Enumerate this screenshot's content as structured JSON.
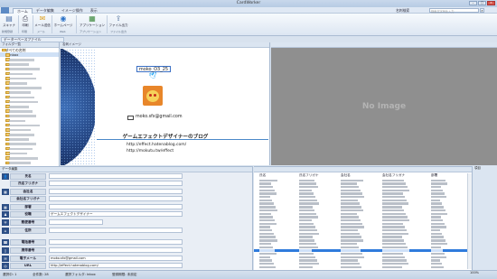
{
  "window": {
    "title": "CardWorker",
    "min": "–",
    "max": "□",
    "close": "×"
  },
  "menu": {
    "tabs": [
      "ホーム",
      "データ編集",
      "イメージ操作",
      "表示"
    ],
    "search_label": "名刺検索",
    "search_placeholder": "検索文字列を入力",
    "search_icon": "⌕"
  },
  "ribbon": {
    "buttons": [
      {
        "label": "スキャナ",
        "icon": "scanner-icon",
        "glyph": "▤"
      },
      {
        "label": "印刷",
        "icon": "printer-icon",
        "glyph": "⎙"
      },
      {
        "label": "メール送信",
        "icon": "mail-icon",
        "glyph": "✉"
      },
      {
        "label": "ホームページ",
        "icon": "globe-icon",
        "glyph": "◉"
      },
      {
        "label": "アプリケーション",
        "icon": "app-icon",
        "glyph": "▦"
      },
      {
        "label": "ファイル出力",
        "icon": "export-icon",
        "glyph": "⇪"
      }
    ],
    "groups": [
      "新規登録",
      "印刷",
      "メール",
      "Web",
      "アプリケーション",
      "ファイル出力"
    ]
  },
  "doc_tab": "データーベースファイル",
  "folders": {
    "header": "フォルダ一覧",
    "root": "すべての名刺",
    "items": [
      {
        "label": "Inbox",
        "selected": true
      },
      {
        "label": ""
      },
      {
        "label": ""
      },
      {
        "label": ""
      },
      {
        "label": ""
      },
      {
        "label": ""
      },
      {
        "label": ""
      },
      {
        "label": ""
      },
      {
        "label": ""
      },
      {
        "label": ""
      },
      {
        "label": ""
      },
      {
        "label": ""
      },
      {
        "label": ""
      },
      {
        "label": ""
      },
      {
        "label": ""
      },
      {
        "label": ""
      },
      {
        "label": ""
      },
      {
        "label": ""
      },
      {
        "label": ""
      },
      {
        "label": ""
      },
      {
        "label": ""
      },
      {
        "label": ""
      },
      {
        "label": ""
      },
      {
        "label": ""
      },
      {
        "label": ""
      },
      {
        "label": ""
      },
      {
        "label": ""
      },
      {
        "label": ""
      }
    ],
    "bottom": [
      "送信済み",
      "リムーバブルメディア",
      "ごみ箱"
    ]
  },
  "card": {
    "header": "名刺イメージ",
    "name": "moko_O3_25",
    "email": "moko.sfx@gmail.com",
    "blog_title": "ゲームエフェクトデザイナーのブログ",
    "url1": "http://effect.hatenablog.com/",
    "url2": "http://mokutu.tw/effect"
  },
  "preview": {
    "no_image": "No Image"
  },
  "data_pane": {
    "header": "データ編集",
    "fields": [
      {
        "label": "氏名",
        "value": "",
        "icon": "person-icon",
        "glyph": "👤"
      },
      {
        "label": "氏名フリガナ",
        "value": "",
        "icon": "none",
        "glyph": ""
      },
      {
        "label": "会社名",
        "value": "",
        "icon": "company-icon",
        "glyph": "▦"
      },
      {
        "label": "会社名フリガナ",
        "value": "",
        "icon": "none",
        "glyph": ""
      },
      {
        "label": "部署",
        "value": "",
        "icon": "dept-icon",
        "glyph": "▦"
      },
      {
        "label": "役職",
        "value": "ゲームエフェクトデザイナー",
        "icon": "title-icon",
        "glyph": "♟"
      },
      {
        "label": "郵便番号",
        "value": "",
        "icon": "post-icon",
        "glyph": "〒"
      },
      {
        "label": "住所",
        "value": "",
        "icon": "address-icon",
        "glyph": "⌂"
      },
      {
        "label": "電話番号",
        "value": "",
        "icon": "phone-icon",
        "glyph": "☎"
      },
      {
        "label": "携帯番号",
        "value": "",
        "icon": "mobile-icon",
        "glyph": "▯"
      },
      {
        "label": "電子メール",
        "value": "moko.sfx@gmail.com",
        "icon": "mail-icon",
        "glyph": "✉"
      },
      {
        "label": "URL",
        "value": "http://effect.hatenablog.com/",
        "icon": "url-icon",
        "glyph": "◎"
      }
    ]
  },
  "list": {
    "columns": [
      "氏名",
      "氏名フリガナ",
      "会社名",
      "会社名フリガナ",
      "部署"
    ],
    "selected_row": 21
  },
  "side_pane": {
    "header": "項目"
  },
  "status": {
    "left": "選択中: 1",
    "count": "全件数: 28",
    "folder": "選択フォルダ: Inbox",
    "info": "登録期限: 未設定",
    "zoom": "100%"
  }
}
